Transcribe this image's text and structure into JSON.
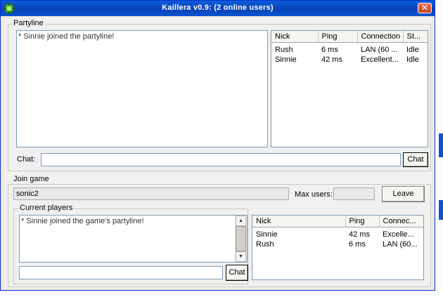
{
  "window": {
    "title": "Kaillera v0.9: (2 online users)",
    "close_label": "✕"
  },
  "partyline": {
    "label": "Partyline",
    "messages": [
      "* Sinnie joined the partyline!"
    ],
    "users_columns": [
      "Nick",
      "Ping",
      "Connection",
      "St..."
    ],
    "users": [
      [
        "Rush",
        "6 ms",
        "LAN (60 ...",
        "Idle"
      ],
      [
        "Sinnie",
        "42 ms",
        "Excellent...",
        "Idle"
      ]
    ],
    "chat_label": "Chat:",
    "chat_value": "",
    "chat_button": "Chat"
  },
  "join_game": {
    "label": "Join game",
    "game_name": "sonic2",
    "max_users_label": "Max users:",
    "max_users_value": "",
    "leave_button": "Leave",
    "current_players": {
      "label": "Current players",
      "messages": [
        "* Sinnie joined the game's partyline!"
      ],
      "columns": [
        "Nick",
        "Ping",
        "Connec..."
      ],
      "players": [
        [
          "Sinnie",
          "42 ms",
          "Excelle..."
        ],
        [
          "Rush",
          "6 ms",
          "LAN (60..."
        ]
      ],
      "chat_value": "",
      "chat_button": "Chat"
    }
  },
  "colors": {
    "titlebar": "#0a5fd8",
    "window_border": "#0831d9"
  }
}
